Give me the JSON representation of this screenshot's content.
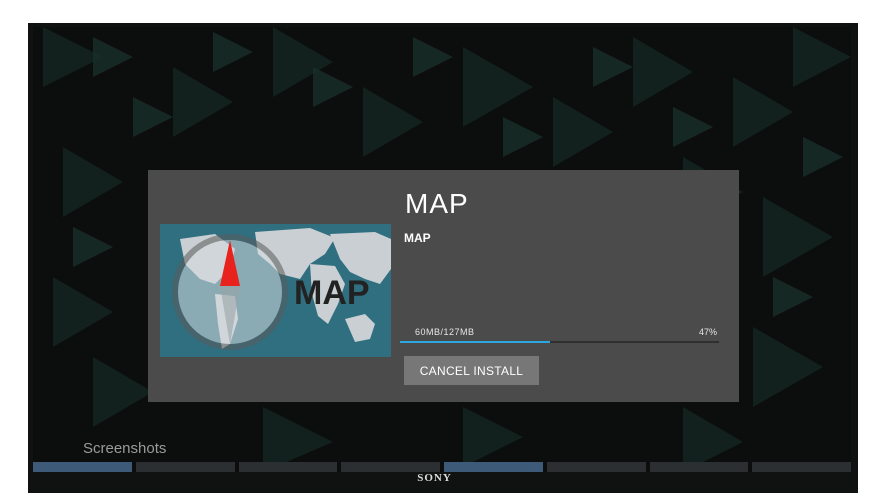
{
  "dialog": {
    "title": "MAP",
    "subtitle": "MAP",
    "thumbnail_text": "MAP",
    "thumbnail_icon": "compass-world-map-icon",
    "progress": {
      "text": "60MB/127MB",
      "percent_text": "47%",
      "fraction": 0.47
    },
    "cancel_label": "CANCEL INSTALL"
  },
  "screenshots_label": "Screenshots",
  "brand": "SONY",
  "colors": {
    "dialog_bg": "#4b4b4b",
    "accent": "#2ea7de",
    "button_bg": "#777777"
  }
}
